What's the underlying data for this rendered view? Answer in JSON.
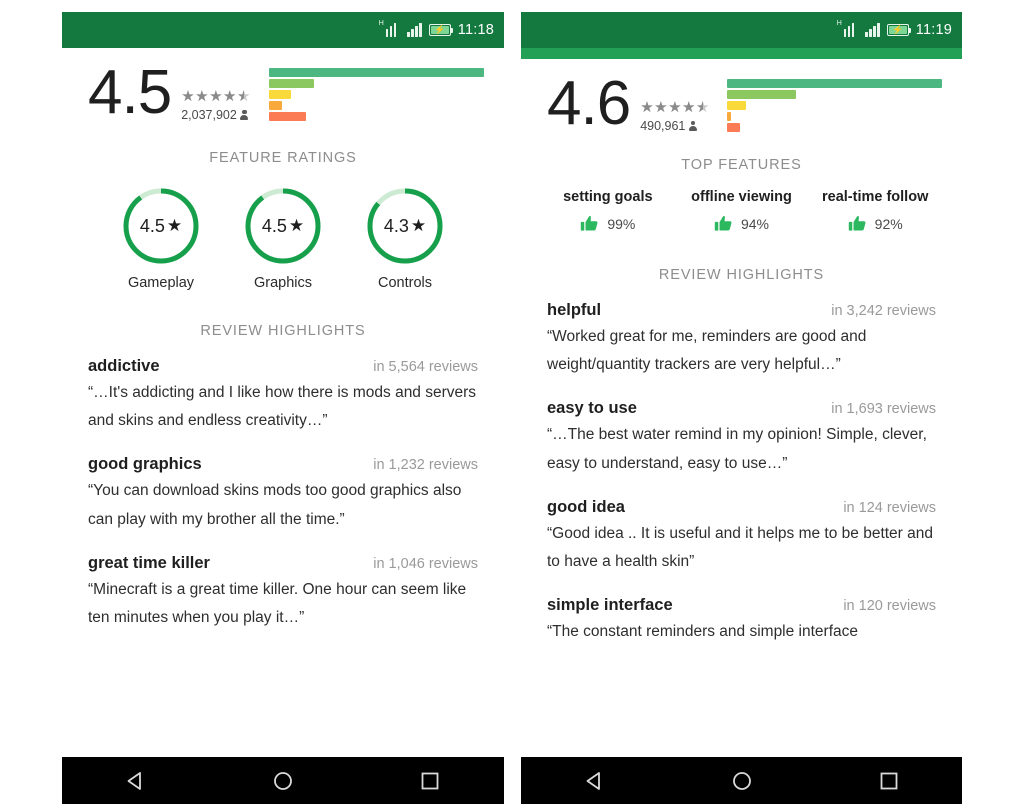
{
  "panels": [
    {
      "id": "left",
      "status_bar": {
        "time": "11:18",
        "network_type": "H",
        "icons": [
          "signal-icon",
          "signal-icon",
          "battery-charging-icon"
        ],
        "bg_color": "#13793f",
        "has_accent_band": false
      },
      "rating": {
        "score": "4.5",
        "stars_filled": 4.5,
        "review_count": "2,037,902",
        "histogram": [
          {
            "label": "5-star",
            "pct": 100,
            "color": "#4cb781"
          },
          {
            "label": "4-star",
            "pct": 21,
            "color": "#8cc860"
          },
          {
            "label": "3-star",
            "pct": 10,
            "color": "#fad93b"
          },
          {
            "label": "2-star",
            "pct": 6,
            "color": "#f9a83b"
          },
          {
            "label": "1-star",
            "pct": 17,
            "color": "#fa7b54"
          }
        ]
      },
      "feature_section": {
        "title": "FEATURE RATINGS",
        "type": "circles",
        "items": [
          {
            "label": "Gameplay",
            "value": "4.5",
            "pct": 90
          },
          {
            "label": "Graphics",
            "value": "4.5",
            "pct": 90
          },
          {
            "label": "Controls",
            "value": "4.3",
            "pct": 86
          }
        ]
      },
      "reviews_title": "REVIEW HIGHLIGHTS",
      "reviews": [
        {
          "term": "addictive",
          "count": "in 5,564 reviews",
          "text": "“…It's addicting and I like how there is mods and servers and skins and endless creativity…”"
        },
        {
          "term": "good graphics",
          "count": "in 1,232 reviews",
          "text": "“You can download skins mods too good graphics also can play with my brother all the time.”"
        },
        {
          "term": "great time killer",
          "count": "in 1,046 reviews",
          "text": "“Minecraft is a great time killer. One hour can seem like ten minutes when you play it…”"
        }
      ]
    },
    {
      "id": "right",
      "status_bar": {
        "time": "11:19",
        "network_type": "H",
        "icons": [
          "signal-icon",
          "signal-icon",
          "battery-charging-icon"
        ],
        "bg_color": "#13793f",
        "has_accent_band": true,
        "accent_band_color": "#22a055"
      },
      "rating": {
        "score": "4.6",
        "stars_filled": 4.5,
        "review_count": "490,961",
        "histogram": [
          {
            "label": "5-star",
            "pct": 100,
            "color": "#4cb781"
          },
          {
            "label": "4-star",
            "pct": 32,
            "color": "#8cc860"
          },
          {
            "label": "3-star",
            "pct": 9,
            "color": "#fad93b"
          },
          {
            "label": "2-star",
            "pct": 2,
            "color": "#f9a83b"
          },
          {
            "label": "1-star",
            "pct": 6,
            "color": "#fa7b54"
          }
        ]
      },
      "feature_section": {
        "title": "TOP FEATURES",
        "type": "thumbs",
        "items": [
          {
            "label": "setting goals",
            "value": "99%"
          },
          {
            "label": "offline viewing",
            "value": "94%"
          },
          {
            "label": "real-time follow",
            "value": "92%"
          }
        ]
      },
      "reviews_title": "REVIEW HIGHLIGHTS",
      "reviews": [
        {
          "term": "helpful",
          "count": "in 3,242 reviews",
          "text": "“Worked great for me, reminders are good and weight/quantity trackers are very helpful…”"
        },
        {
          "term": "easy to use",
          "count": "in 1,693 reviews",
          "text": "“…The best water remind in my opinion! Simple, clever, easy to understand, easy to use…”"
        },
        {
          "term": "good idea",
          "count": "in 124 reviews",
          "text": "“Good idea .. It is useful and it helps me to be better and to have a health skin”"
        },
        {
          "term": "simple interface",
          "count": "in 120 reviews",
          "text": "“The constant reminders and simple interface"
        }
      ]
    }
  ],
  "nav_bar": {
    "bg_color": "#000000",
    "buttons": [
      {
        "name": "back-icon",
        "glyph": "◁"
      },
      {
        "name": "home-icon",
        "glyph": "○"
      },
      {
        "name": "recents-icon",
        "glyph": "□"
      }
    ]
  },
  "theme": {
    "ring_color": "#17a04c",
    "ring_track_color": "#cdebd3",
    "thumb_color": "#2bb85f",
    "section_title_color": "#8d8d8d"
  }
}
